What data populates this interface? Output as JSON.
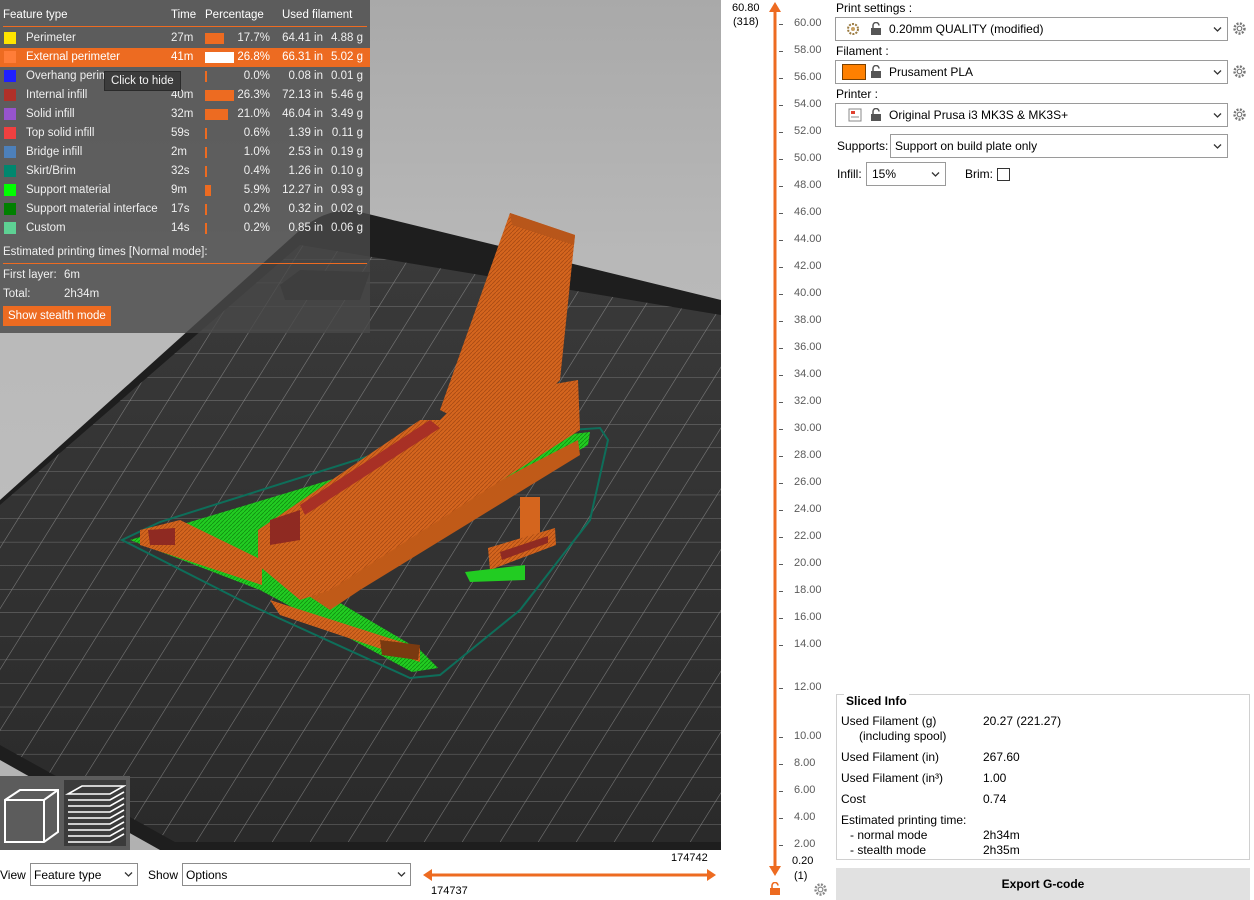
{
  "legend": {
    "headers": {
      "feature": "Feature type",
      "time": "Time",
      "percentage": "Percentage",
      "used": "Used filament"
    },
    "rows": [
      {
        "label": "Perimeter",
        "color": "#ffe500",
        "time": "27m",
        "pct": "17.7%",
        "pct_value": 0.177,
        "length": "64.41 in",
        "weight": "4.88 g",
        "highlighted": false
      },
      {
        "label": "External perimeter",
        "color": "#ff7d38",
        "time": "41m",
        "pct": "26.8%",
        "pct_value": 0.268,
        "length": "66.31 in",
        "weight": "5.02 g",
        "highlighted": true
      },
      {
        "label": "Overhang perimeter",
        "color": "#1f1fff",
        "time": "",
        "pct": "0.0%",
        "pct_value": 0.0,
        "length": "0.08 in",
        "weight": "0.01 g",
        "highlighted": false
      },
      {
        "label": "Internal infill",
        "color": "#b03029",
        "time": "40m",
        "pct": "26.3%",
        "pct_value": 0.263,
        "length": "72.13 in",
        "weight": "5.46 g",
        "highlighted": false
      },
      {
        "label": "Solid infill",
        "color": "#9654cc",
        "time": "32m",
        "pct": "21.0%",
        "pct_value": 0.21,
        "length": "46.04 in",
        "weight": "3.49 g",
        "highlighted": false
      },
      {
        "label": "Top solid infill",
        "color": "#f04040",
        "time": "59s",
        "pct": "0.6%",
        "pct_value": 0.006,
        "length": "1.39 in",
        "weight": "0.11 g",
        "highlighted": false
      },
      {
        "label": "Bridge infill",
        "color": "#4d80ba",
        "time": "2m",
        "pct": "1.0%",
        "pct_value": 0.01,
        "length": "2.53 in",
        "weight": "0.19 g",
        "highlighted": false
      },
      {
        "label": "Skirt/Brim",
        "color": "#00876e",
        "time": "32s",
        "pct": "0.4%",
        "pct_value": 0.004,
        "length": "1.26 in",
        "weight": "0.10 g",
        "highlighted": false
      },
      {
        "label": "Support material",
        "color": "#00ff00",
        "time": "9m",
        "pct": "5.9%",
        "pct_value": 0.059,
        "length": "12.27 in",
        "weight": "0.93 g",
        "highlighted": false
      },
      {
        "label": "Support material interface",
        "color": "#008000",
        "time": "17s",
        "pct": "0.2%",
        "pct_value": 0.002,
        "length": "0.32 in",
        "weight": "0.02 g",
        "highlighted": false
      },
      {
        "label": "Custom",
        "color": "#5ed194",
        "time": "14s",
        "pct": "0.2%",
        "pct_value": 0.002,
        "length": "0.85 in",
        "weight": "0.06 g",
        "highlighted": false
      }
    ],
    "tooltip": "Click to hide",
    "estimated_header": "Estimated printing times [Normal mode]:",
    "first_layer_label": "First layer:",
    "first_layer_value": "6m",
    "total_label": "Total:",
    "total_value": "2h34m",
    "stealth_button": "Show stealth mode"
  },
  "bottom_bar": {
    "view_label": "View",
    "view_value": "Feature type",
    "show_label": "Show",
    "show_value": "Options",
    "h_slider_upper": "174742",
    "h_slider_lower": "174737"
  },
  "layer_slider": {
    "top_height": "60.80",
    "top_layer": "(318)",
    "bottom_height": "0.20",
    "bottom_layer": "(1)",
    "ticks": [
      "60.00",
      "58.00",
      "56.00",
      "54.00",
      "52.00",
      "50.00",
      "48.00",
      "46.00",
      "44.00",
      "42.00",
      "40.00",
      "38.00",
      "36.00",
      "34.00",
      "32.00",
      "30.00",
      "28.00",
      "26.00",
      "24.00",
      "22.00",
      "20.00",
      "18.00",
      "16.00",
      "14.00",
      "12.00",
      "10.00",
      "8.00",
      "6.00",
      "4.00",
      "2.00"
    ]
  },
  "right_panel": {
    "print_settings_label": "Print settings :",
    "print_settings_value": "0.20mm QUALITY (modified)",
    "filament_label": "Filament :",
    "filament_value": "Prusament PLA",
    "filament_color": "#ff8000",
    "printer_label": "Printer :",
    "printer_value": "Original Prusa i3 MK3S & MK3S+",
    "supports_label": "Supports:",
    "supports_value": "Support on build plate only",
    "infill_label": "Infill:",
    "infill_value": "15%",
    "brim_label": "Brim:",
    "brim_checked": false,
    "sliced_info": {
      "title": "Sliced Info",
      "filament_g_label": "Used Filament (g)",
      "filament_g_sub": "(including spool)",
      "filament_g_value": "20.27 (221.27)",
      "filament_in_label": "Used Filament (in)",
      "filament_in_value": "267.60",
      "filament_in3_label": "Used Filament (in³)",
      "filament_in3_value": "1.00",
      "cost_label": "Cost",
      "cost_value": "0.74",
      "est_time_label": "Estimated printing time:",
      "normal_label": "- normal mode",
      "normal_value": "2h34m",
      "stealth_label": "- stealth mode",
      "stealth_value": "2h35m"
    },
    "export_button": "Export G-code"
  },
  "colors": {
    "accent": "#ed6b21",
    "model_orange": "#d7651c",
    "support_green": "#19c819",
    "skirt": "#0e6e5a"
  }
}
